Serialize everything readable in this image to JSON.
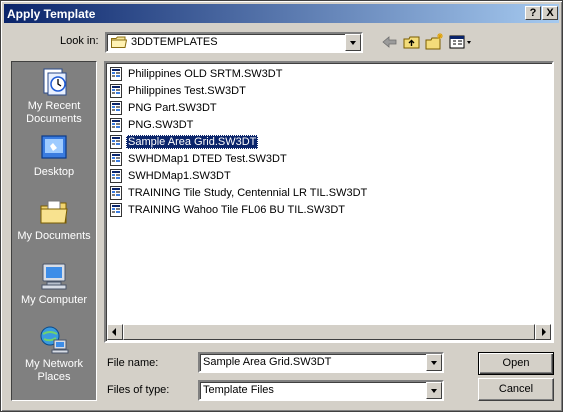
{
  "window": {
    "title": "Apply Template",
    "help_glyph": "?",
    "close_glyph": "X"
  },
  "look_in": {
    "label": "Look in:",
    "label_hotkey": "i",
    "value": "3DDTEMPLATES",
    "icon": "folder-icon"
  },
  "toolbar": {
    "back_icon": "back-arrow-icon",
    "up_icon": "up-folder-icon",
    "new_folder_icon": "new-folder-icon",
    "view_menu_icon": "view-menu-icon"
  },
  "places": [
    {
      "label_line1": "My Recent",
      "label_line2": "Documents",
      "icon": "recent-documents-icon"
    },
    {
      "label_line1": "Desktop",
      "label_line2": "",
      "icon": "desktop-icon"
    },
    {
      "label_line1": "My Documents",
      "label_line2": "",
      "icon": "my-documents-icon"
    },
    {
      "label_line1": "My Computer",
      "label_line2": "",
      "icon": "my-computer-icon"
    },
    {
      "label_line1": "My Network",
      "label_line2": "Places",
      "icon": "network-places-icon"
    }
  ],
  "files": [
    {
      "name": "Philippines OLD SRTM.SW3DT",
      "selected": false
    },
    {
      "name": "Philippines Test.SW3DT",
      "selected": false
    },
    {
      "name": "PNG Part.SW3DT",
      "selected": false
    },
    {
      "name": "PNG.SW3DT",
      "selected": false
    },
    {
      "name": "Sample Area Grid.SW3DT",
      "selected": true
    },
    {
      "name": "SWHDMap1 DTED Test.SW3DT",
      "selected": false
    },
    {
      "name": "SWHDMap1.SW3DT",
      "selected": false
    },
    {
      "name": "TRAINING Tile Study, Centennial LR TIL.SW3DT",
      "selected": false
    },
    {
      "name": "TRAINING Wahoo Tile FL06 BU TIL.SW3DT",
      "selected": false
    }
  ],
  "file_name": {
    "label": "File name:",
    "value": "Sample Area Grid.SW3DT"
  },
  "file_type": {
    "label": "Files of type:",
    "value": "Template Files"
  },
  "buttons": {
    "open": "Open",
    "cancel": "Cancel"
  },
  "colors": {
    "titlebar_start": "#0a246a",
    "titlebar_end": "#a6caf0",
    "face": "#d4d0c8",
    "selection": "#0a246a",
    "places_bar": "#808080"
  }
}
